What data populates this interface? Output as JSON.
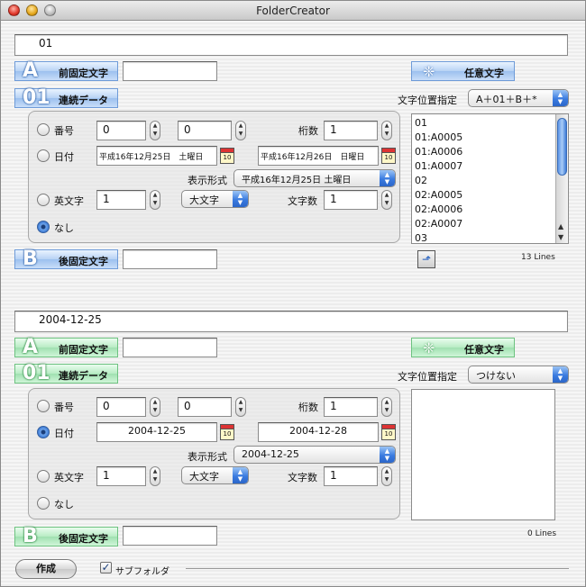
{
  "window": {
    "title": "FolderCreator"
  },
  "panel_top": {
    "preview": "01",
    "prefix": {
      "glyph": "A",
      "label": "前固定文字",
      "value": ""
    },
    "arbitrary": {
      "glyph": "❈",
      "label": "任意文字"
    },
    "sequence": {
      "glyph": "01",
      "label": "連続データ"
    },
    "char_position": {
      "label": "文字位置指定",
      "value": "A＋01＋B＋*"
    },
    "number": {
      "label": "番号",
      "from": "0",
      "to": "0",
      "digits_label": "桁数",
      "digits": "1"
    },
    "date": {
      "label": "日付",
      "from": "平成16年12月25日　土曜日",
      "to": "平成16年12月26日　日曜日",
      "format_label": "表示形式",
      "format": "平成16年12月25日 土曜日"
    },
    "alpha": {
      "label": "英文字",
      "start": "1",
      "case": "大文字",
      "count_label": "文字数",
      "count": "1"
    },
    "none": {
      "label": "なし"
    },
    "selected": "none",
    "list": [
      "01",
      "01:A0005",
      "01:A0006",
      "01:A0007",
      "02",
      "02:A0005",
      "02:A0006",
      "02:A0007",
      "03"
    ],
    "line_count": "13 Lines",
    "suffix": {
      "glyph": "B",
      "label": "後固定文字",
      "value": ""
    }
  },
  "panel_bottom": {
    "preview": "2004-12-25",
    "prefix": {
      "glyph": "A",
      "label": "前固定文字",
      "value": ""
    },
    "arbitrary": {
      "glyph": "❈",
      "label": "任意文字"
    },
    "sequence": {
      "glyph": "01",
      "label": "連続データ"
    },
    "char_position": {
      "label": "文字位置指定",
      "value": "つけない"
    },
    "number": {
      "label": "番号",
      "from": "0",
      "to": "0",
      "digits_label": "桁数",
      "digits": "1"
    },
    "date": {
      "label": "日付",
      "from": "2004-12-25",
      "to": "2004-12-28",
      "format_label": "表示形式",
      "format": "2004-12-25"
    },
    "alpha": {
      "label": "英文字",
      "start": "1",
      "case": "大文字",
      "count_label": "文字数",
      "count": "1"
    },
    "none": {
      "label": "なし"
    },
    "selected": "date",
    "list": [],
    "line_count": "0 Lines",
    "suffix": {
      "glyph": "B",
      "label": "後固定文字",
      "value": ""
    }
  },
  "footer": {
    "create_label": "作成",
    "subfolder_label": "サブフォルダ",
    "subfolder_checked": "✓"
  },
  "colors": {
    "blue_accent": "#9bc0ee",
    "green_accent": "#9fe0b0",
    "selection": "#2f6fd0"
  }
}
